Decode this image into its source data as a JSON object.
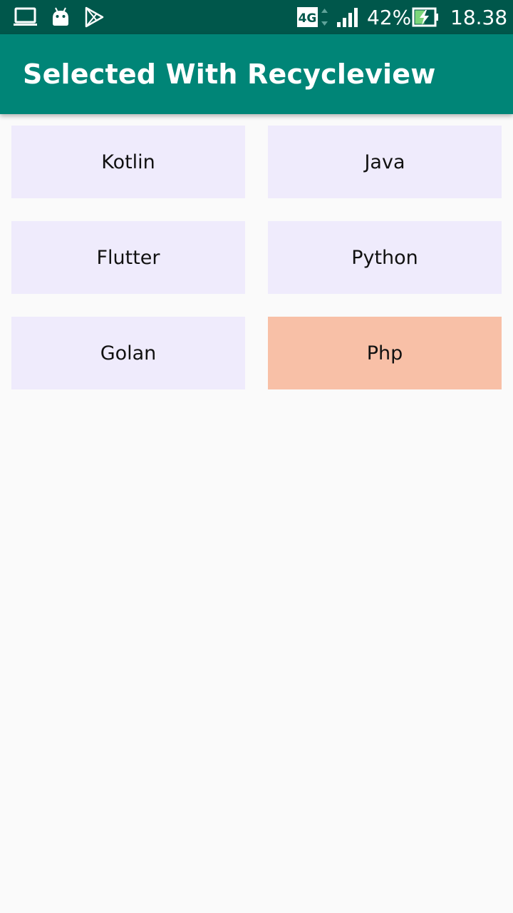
{
  "status_bar": {
    "icons": [
      "laptop-icon",
      "android-icon",
      "play-store-icon",
      "network-4g-icon",
      "signal-icon",
      "battery-charging-icon"
    ],
    "network": "4G",
    "battery_percent": "42%",
    "time": "18.38",
    "colors": {
      "background": "#00574b",
      "foreground": "#ffffff"
    }
  },
  "app_bar": {
    "title": "Selected With Recycleview",
    "color": "#008577"
  },
  "items": [
    {
      "label": "Kotlin",
      "selected": false
    },
    {
      "label": "Java",
      "selected": false
    },
    {
      "label": "Flutter",
      "selected": false
    },
    {
      "label": "Python",
      "selected": false
    },
    {
      "label": "Golan",
      "selected": false
    },
    {
      "label": "Php",
      "selected": true
    }
  ],
  "colors": {
    "card_default": "#efebfc",
    "card_selected": "#f8c0a7",
    "background": "#fafafa"
  }
}
